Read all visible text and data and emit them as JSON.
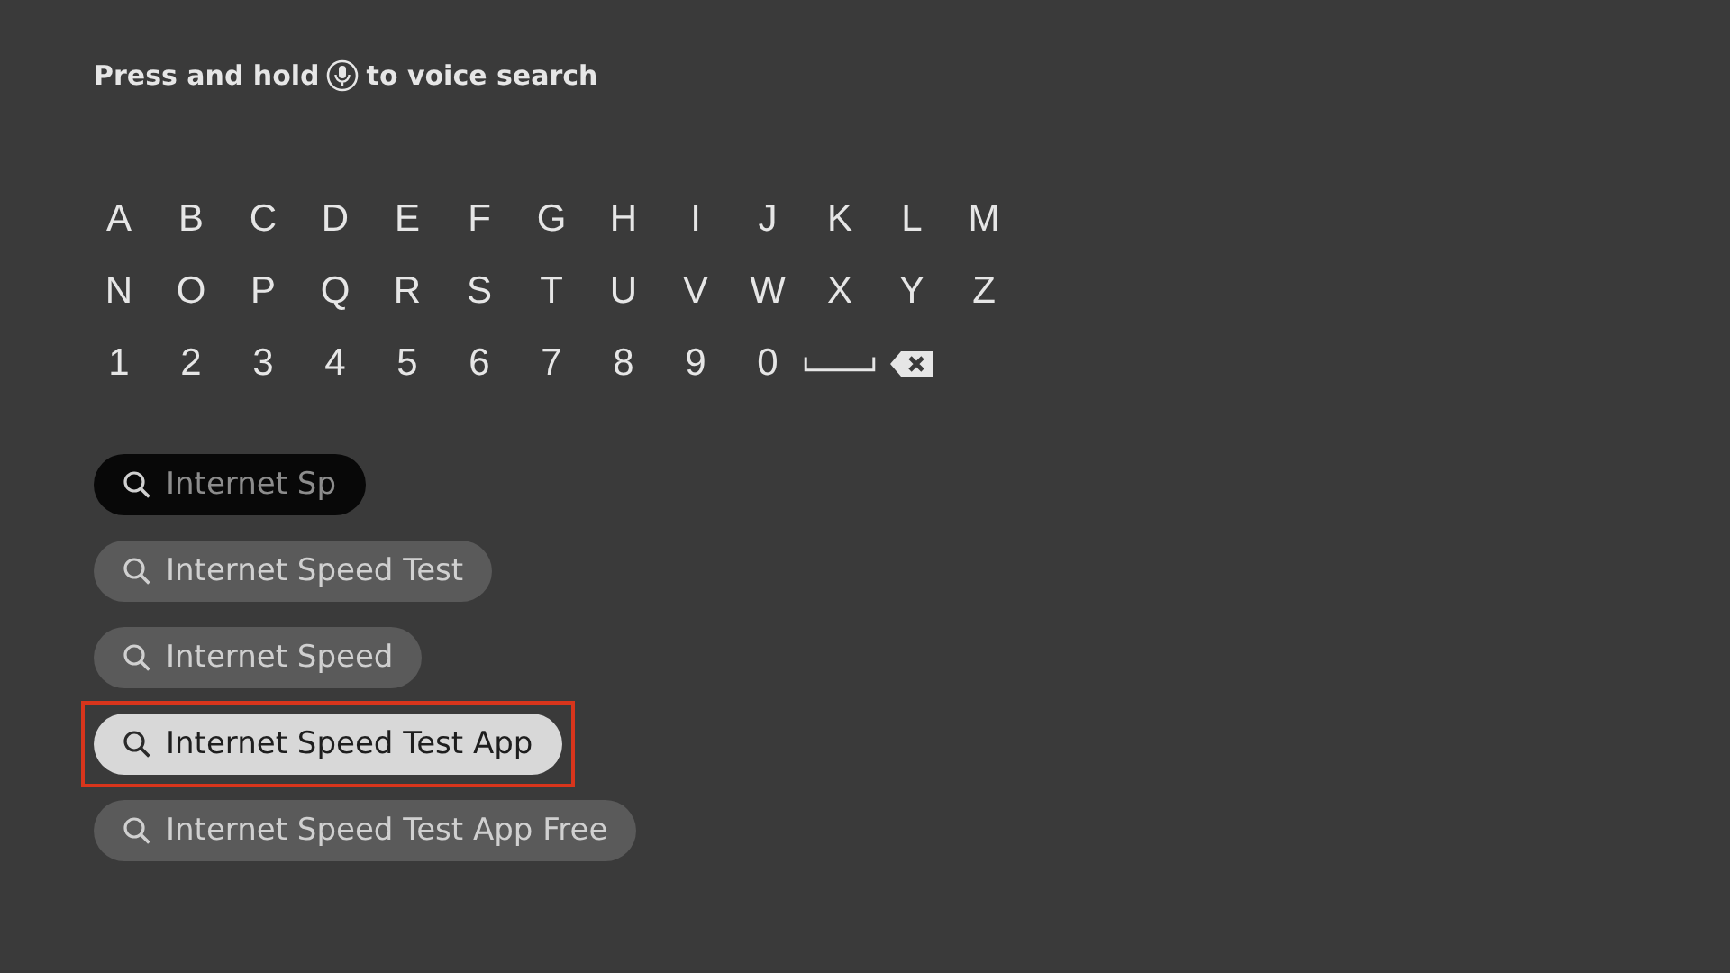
{
  "hint": {
    "before": "Press and hold",
    "after": "to voice search"
  },
  "keyboard": {
    "rows": [
      [
        {
          "kind": "char",
          "label": "A"
        },
        {
          "kind": "char",
          "label": "B"
        },
        {
          "kind": "char",
          "label": "C"
        },
        {
          "kind": "char",
          "label": "D"
        },
        {
          "kind": "char",
          "label": "E"
        },
        {
          "kind": "char",
          "label": "F"
        },
        {
          "kind": "char",
          "label": "G"
        },
        {
          "kind": "char",
          "label": "H"
        },
        {
          "kind": "char",
          "label": "I"
        },
        {
          "kind": "char",
          "label": "J"
        },
        {
          "kind": "char",
          "label": "K"
        },
        {
          "kind": "char",
          "label": "L"
        },
        {
          "kind": "char",
          "label": "M"
        }
      ],
      [
        {
          "kind": "char",
          "label": "N"
        },
        {
          "kind": "char",
          "label": "O"
        },
        {
          "kind": "char",
          "label": "P"
        },
        {
          "kind": "char",
          "label": "Q"
        },
        {
          "kind": "char",
          "label": "R"
        },
        {
          "kind": "char",
          "label": "S"
        },
        {
          "kind": "char",
          "label": "T"
        },
        {
          "kind": "char",
          "label": "U"
        },
        {
          "kind": "char",
          "label": "V"
        },
        {
          "kind": "char",
          "label": "W"
        },
        {
          "kind": "char",
          "label": "X"
        },
        {
          "kind": "char",
          "label": "Y"
        },
        {
          "kind": "char",
          "label": "Z"
        }
      ],
      [
        {
          "kind": "char",
          "label": "1"
        },
        {
          "kind": "char",
          "label": "2"
        },
        {
          "kind": "char",
          "label": "3"
        },
        {
          "kind": "char",
          "label": "4"
        },
        {
          "kind": "char",
          "label": "5"
        },
        {
          "kind": "char",
          "label": "6"
        },
        {
          "kind": "char",
          "label": "7"
        },
        {
          "kind": "char",
          "label": "8"
        },
        {
          "kind": "char",
          "label": "9"
        },
        {
          "kind": "char",
          "label": "0"
        },
        {
          "kind": "space"
        },
        {
          "kind": "backspace"
        }
      ]
    ]
  },
  "suggestions": [
    {
      "text": "Internet Sp",
      "kind": "faded",
      "selected": false
    },
    {
      "text": "Internet Speed Test",
      "kind": "normal",
      "selected": false
    },
    {
      "text": "Internet Speed",
      "kind": "normal",
      "selected": false
    },
    {
      "text": "Internet Speed Test App",
      "kind": "normal",
      "selected": true
    },
    {
      "text": "Internet Speed Test App Free",
      "kind": "normal",
      "selected": false
    }
  ]
}
